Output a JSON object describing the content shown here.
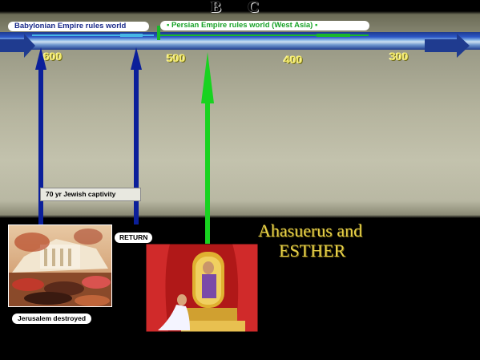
{
  "heading": "B C",
  "eras": {
    "babylon": "Babylonian Empire rules world",
    "persia": "Persian Empire rules world (West Asia)"
  },
  "ticks": [
    "600",
    "500",
    "400",
    "300"
  ],
  "captions": {
    "captivity": "70 yr Jewish captivity",
    "return": "RETURN",
    "destroyed": "Jerusalem destroyed"
  },
  "title": {
    "line1": "Ahasuerus and",
    "line2": "ESTHER"
  },
  "colors": {
    "blue_arrow": "#0b1f9a",
    "green_arrow": "#18d320",
    "label_gold": "#f2e96a",
    "persia_text": "#1aa32a",
    "babylon_text": "#1a2a8a"
  },
  "images": [
    "jerusalem-burning-painting",
    "esther-before-king-painting"
  ]
}
